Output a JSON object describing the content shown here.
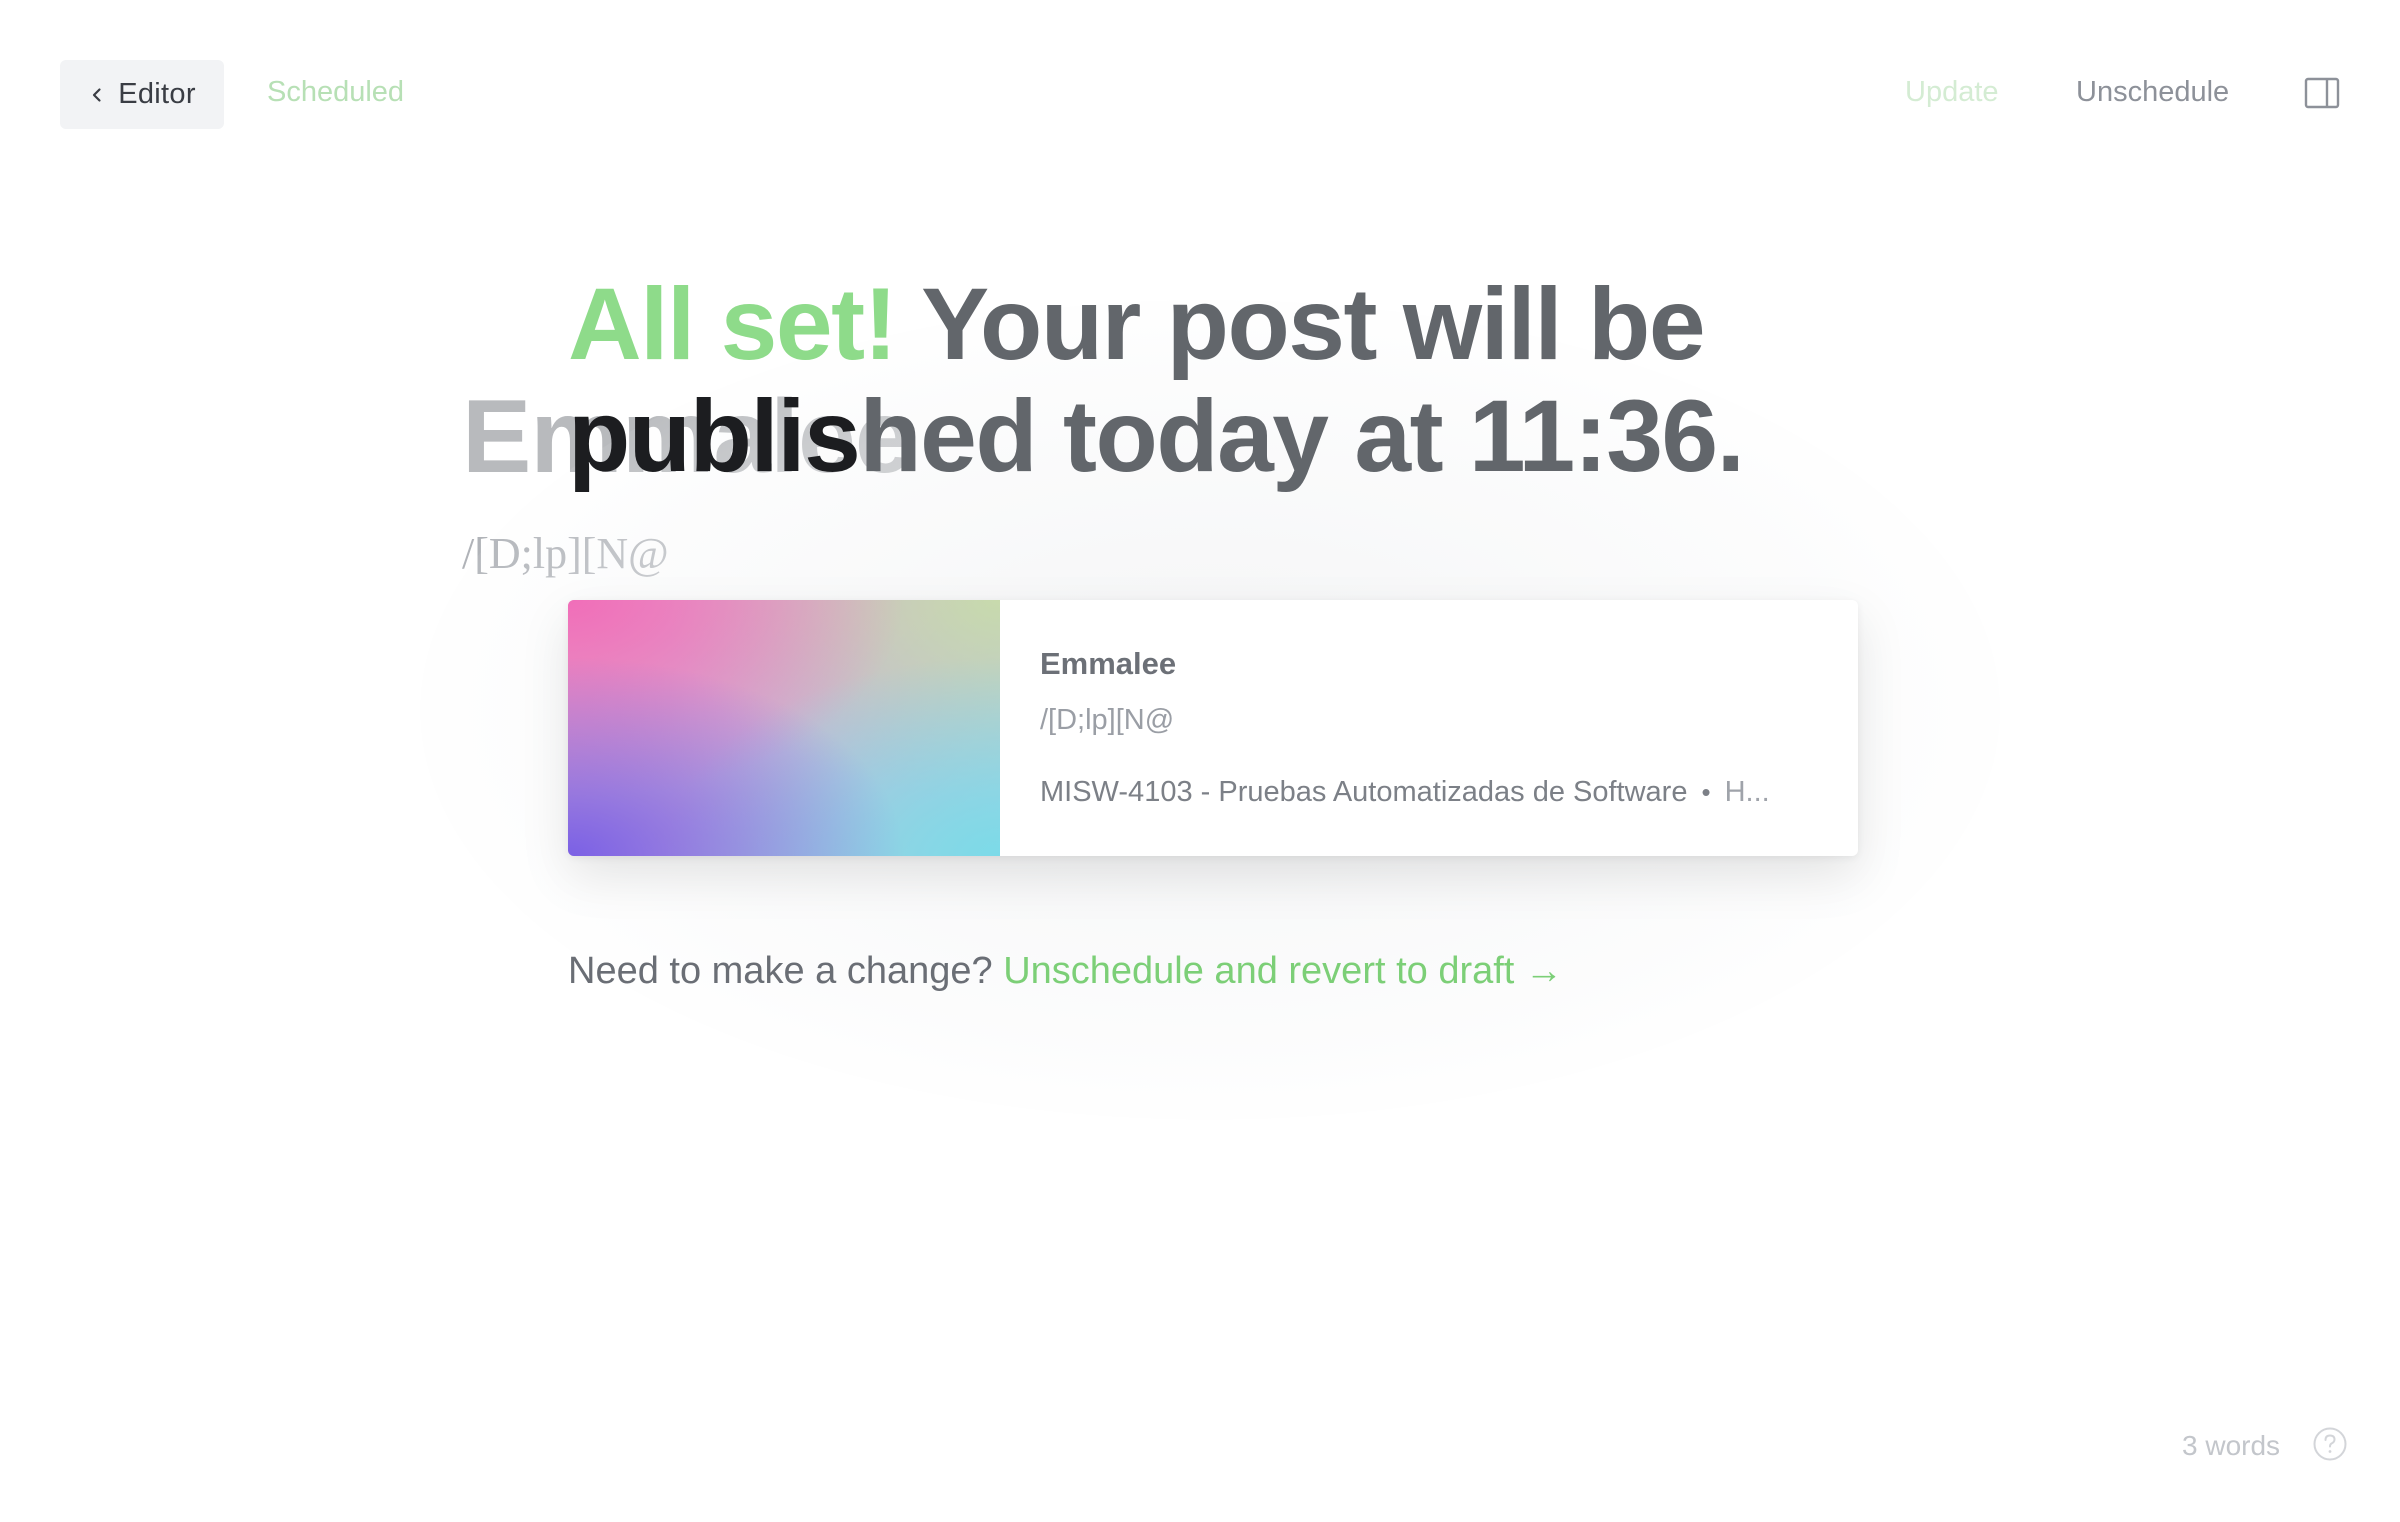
{
  "toolbar": {
    "back_label": "Editor",
    "status": "Scheduled",
    "update_label": "Update",
    "unschedule_label": "Unschedule"
  },
  "editor_background": {
    "title": "Emmalee",
    "excerpt": "/[D;lp][N@"
  },
  "modal": {
    "headline_accent": "All set!",
    "headline_rest": " Your post will be ",
    "headline_dark_prefix": "publis",
    "headline_tail": "hed today at 11:36.",
    "card": {
      "title": "Emmalee",
      "excerpt": "/[D;lp][N@",
      "site": "MISW-4103 - Pruebas Automatizadas de Software",
      "separator": "•",
      "author_truncated": "H..."
    },
    "change_prompt": "Need to make a change?",
    "revert_link": "Unschedule and revert to draft →"
  },
  "footer": {
    "word_count": "3 words"
  },
  "colors": {
    "accent_green": "#8edb8a",
    "link_green": "#7ccf77",
    "headline_gray": "#62666b"
  },
  "icons": {
    "back": "chevron-left-icon",
    "sidebar": "sidebar-toggle-icon",
    "help": "question-mark-circle-icon"
  }
}
